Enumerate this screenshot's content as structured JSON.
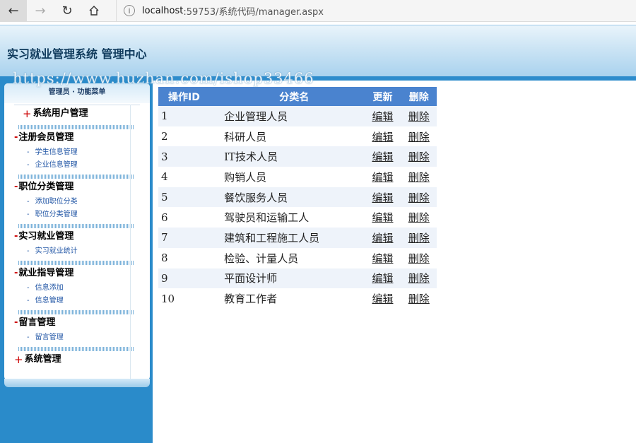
{
  "browser": {
    "url_host": "localhost",
    "url_rest": ":59753/系统代码/manager.aspx"
  },
  "header": {
    "title": "实习就业管理系统 管理中心",
    "watermark": "https://www.huzhan.com/ishop33466"
  },
  "sidebar": {
    "head": "管理员 · 功能菜单",
    "groups": [
      {
        "sign": "+",
        "title": "系统用户管理",
        "items": []
      },
      {
        "sign": "-",
        "title": "注册会员管理",
        "items": [
          "学生信息管理",
          "企业信息管理"
        ]
      },
      {
        "sign": "-",
        "title": "职位分类管理",
        "items": [
          "添加职位分类",
          "职位分类管理"
        ]
      },
      {
        "sign": "-",
        "title": "实习就业管理",
        "items": [
          "实习就业统计"
        ]
      },
      {
        "sign": "-",
        "title": "就业指导管理",
        "items": [
          "信息添加",
          "信息管理"
        ]
      },
      {
        "sign": "-",
        "title": "留言管理",
        "items": [
          "留言管理"
        ]
      },
      {
        "sign": "+",
        "title": "系统管理",
        "items": []
      }
    ]
  },
  "table": {
    "headers": {
      "id": "操作ID",
      "name": "分类名",
      "edit": "更新",
      "delete": "删除"
    },
    "edit_label": "编辑",
    "delete_label": "删除",
    "rows": [
      {
        "id": "1",
        "name": "企业管理人员"
      },
      {
        "id": "2",
        "name": "科研人员"
      },
      {
        "id": "3",
        "name": "IT技术人员"
      },
      {
        "id": "4",
        "name": "购销人员"
      },
      {
        "id": "5",
        "name": "餐饮服务人员"
      },
      {
        "id": "6",
        "name": "驾驶员和运输工人"
      },
      {
        "id": "7",
        "name": "建筑和工程施工人员"
      },
      {
        "id": "8",
        "name": "检验、计量人员"
      },
      {
        "id": "9",
        "name": "平面设计师"
      },
      {
        "id": "10",
        "name": "教育工作者"
      }
    ]
  }
}
